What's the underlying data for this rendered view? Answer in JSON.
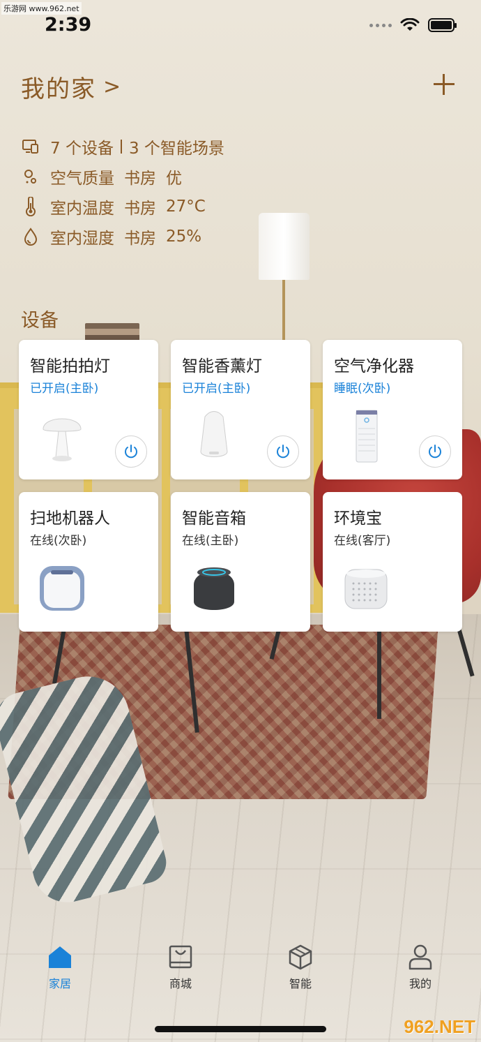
{
  "status_bar": {
    "time": "2:39"
  },
  "watermark_top": "乐游网 www.962.net",
  "watermark_bottom": "962.NET",
  "header": {
    "home_title": "我的家",
    "chevron": ">"
  },
  "summary": {
    "device_count": "7 个设备",
    "scene_count": "3 个智能场景",
    "rows": [
      {
        "label": "空气质量",
        "room": "书房",
        "value": "优"
      },
      {
        "label": "室内温度",
        "room": "书房",
        "value": "27°C"
      },
      {
        "label": "室内湿度",
        "room": "书房",
        "value": "25%"
      }
    ]
  },
  "devices_heading": "设备",
  "devices": [
    {
      "name": "智能拍拍灯",
      "status": "已开启(主卧)",
      "on": true,
      "has_power": true,
      "icon": "mushroom-lamp-icon"
    },
    {
      "name": "智能香薰灯",
      "status": "已开启(主卧)",
      "on": true,
      "has_power": true,
      "icon": "aroma-diffuser-icon"
    },
    {
      "name": "空气净化器",
      "status": "睡眠(次卧)",
      "on": true,
      "has_power": true,
      "icon": "air-purifier-icon"
    },
    {
      "name": "扫地机器人",
      "status": "在线(次卧)",
      "on": false,
      "has_power": false,
      "icon": "robot-vacuum-icon"
    },
    {
      "name": "智能音箱",
      "status": "在线(主卧)",
      "on": false,
      "has_power": false,
      "icon": "smart-speaker-icon"
    },
    {
      "name": "环境宝",
      "status": "在线(客厅)",
      "on": false,
      "has_power": false,
      "icon": "environment-monitor-icon"
    }
  ],
  "tabs": [
    {
      "label": "家居",
      "icon": "home-icon",
      "active": true
    },
    {
      "label": "商城",
      "icon": "shop-icon",
      "active": false
    },
    {
      "label": "智能",
      "icon": "smart-cube-icon",
      "active": false
    },
    {
      "label": "我的",
      "icon": "user-icon",
      "active": false
    }
  ],
  "colors": {
    "accent": "#1a82d8",
    "header_text": "#8a5a27"
  }
}
